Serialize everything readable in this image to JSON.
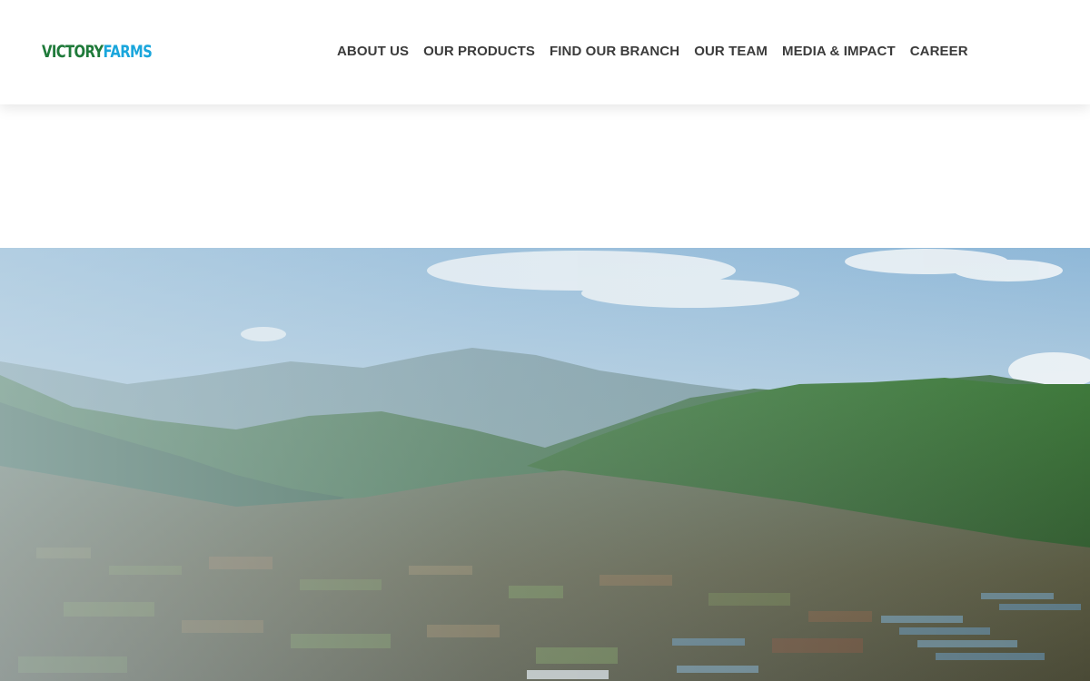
{
  "brand": {
    "logo_victory": "VICTORY",
    "logo_farms": "FARMS",
    "colors": {
      "green": "#1f7a3a",
      "blue": "#1aa6dc"
    },
    "icon": "fish-icon"
  },
  "nav": {
    "items": [
      {
        "label": "ABOUT US"
      },
      {
        "label": "OUR PRODUCTS"
      },
      {
        "label": "FIND OUR BRANCH"
      },
      {
        "label": "OUR TEAM"
      },
      {
        "label": "MEDIA & IMPACT"
      },
      {
        "label": "CAREER"
      }
    ]
  },
  "hero": {
    "image": "aerial-valley-photo"
  }
}
